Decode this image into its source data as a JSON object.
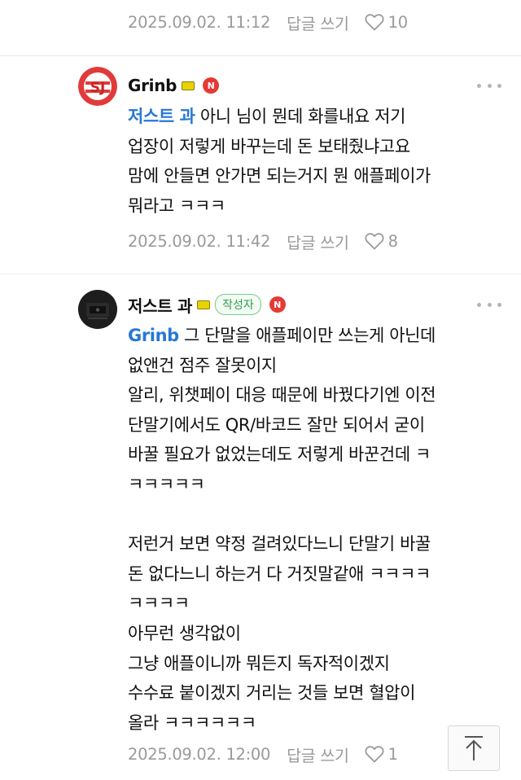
{
  "top_meta": {
    "date": "2025.09.02. 11:12",
    "reply_label": "답글 쓰기",
    "likes": "10"
  },
  "comments": [
    {
      "nick": "Grinb",
      "mention": "저스트 과",
      "first_line_rest": " 아니 님이 뭔데 화를내요 저기",
      "lines": [
        "업장이 저렇게 바꾸는데 돈 보태줬냐고요",
        "맘에 안들면 안가면 되는거지 뭔 애플페이가",
        "뭐라고 ㅋㅋㅋ"
      ],
      "date": "2025.09.02. 11:42",
      "reply_label": "답글 쓰기",
      "likes": "8",
      "avatar_text": "SJ",
      "level_color": "#e8d400"
    },
    {
      "nick": "저스트 과",
      "author_badge": "작성자",
      "mention": "Grinb",
      "first_line_rest": " 그 단말을 애플페이만 쓰는게 아닌데",
      "lines": [
        "없앤건 점주 잘못이지",
        "알리, 위챗페이 대응 때문에 바꿨다기엔 이전",
        "단말기에서도 QR/바코드 잘만 되어서 굳이",
        "바꿀 필요가 없었는데도 저렇게 바꾼건데 ㅋ",
        "ㅋㅋㅋㅋㅋ",
        "",
        "저런거 보면 약정 걸려있다느니 단말기 바꿀",
        "돈 없다느니 하는거 다 거짓말같애 ㅋㅋㅋㅋ",
        "ㅋㅋㅋㅋ",
        "아무런 생각없이",
        "그냥 애플이니까 뭐든지 독자적이겠지",
        "수수료 붙이겠지 거리는 것들 보면 혈압이",
        "올라 ㅋㅋㅋㅋㅋㅋ"
      ],
      "date": "2025.09.02. 12:00",
      "reply_label": "답글 쓰기",
      "likes": "1",
      "level_color": "#e8d400"
    }
  ],
  "n_badge_label": "N",
  "icons": {
    "like": "heart-outline-icon",
    "more": "more-dots-icon",
    "scroll_top": "arrow-up-icon"
  },
  "colors": {
    "mention": "#2777d5",
    "meta": "#9a9a9a",
    "badge_red": "#e53935",
    "author_green": "#2e9e4a"
  }
}
